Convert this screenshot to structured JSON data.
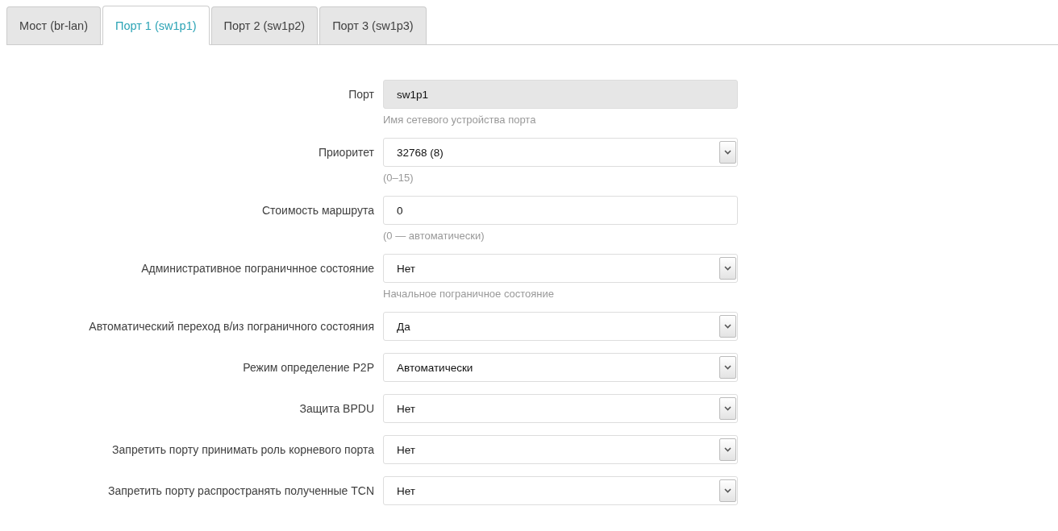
{
  "tabs": [
    {
      "label": "Мост (br-lan)",
      "selected": false
    },
    {
      "label": "Порт 1 (sw1p1)",
      "selected": true
    },
    {
      "label": "Порт 2 (sw1p2)",
      "selected": false
    },
    {
      "label": "Порт 3 (sw1p3)",
      "selected": false
    }
  ],
  "fields": [
    {
      "label": "Порт",
      "kind": "readonly",
      "value": "sw1p1",
      "hint": "Имя сетевого устройства порта"
    },
    {
      "label": "Приоритет",
      "kind": "select",
      "value": "32768 (8)",
      "hint": "(0–15)"
    },
    {
      "label": "Стоимость маршрута",
      "kind": "text",
      "value": "0",
      "hint": "(0 — автоматически)"
    },
    {
      "label": "Административное пограничнное состояние",
      "kind": "select",
      "value": "Нет",
      "hint": "Начальное пограничное состояние"
    },
    {
      "label": "Автоматический переход в/из пограничного состояния",
      "kind": "select",
      "value": "Да"
    },
    {
      "label": "Режим определение P2P",
      "kind": "select",
      "value": "Автоматически"
    },
    {
      "label": "Защита BPDU",
      "kind": "select",
      "value": "Нет"
    },
    {
      "label": "Запретить порту принимать роль корневого порта",
      "kind": "select",
      "value": "Нет"
    },
    {
      "label": "Запретить порту распространять полученные TCN",
      "kind": "select",
      "value": "Нет"
    }
  ]
}
